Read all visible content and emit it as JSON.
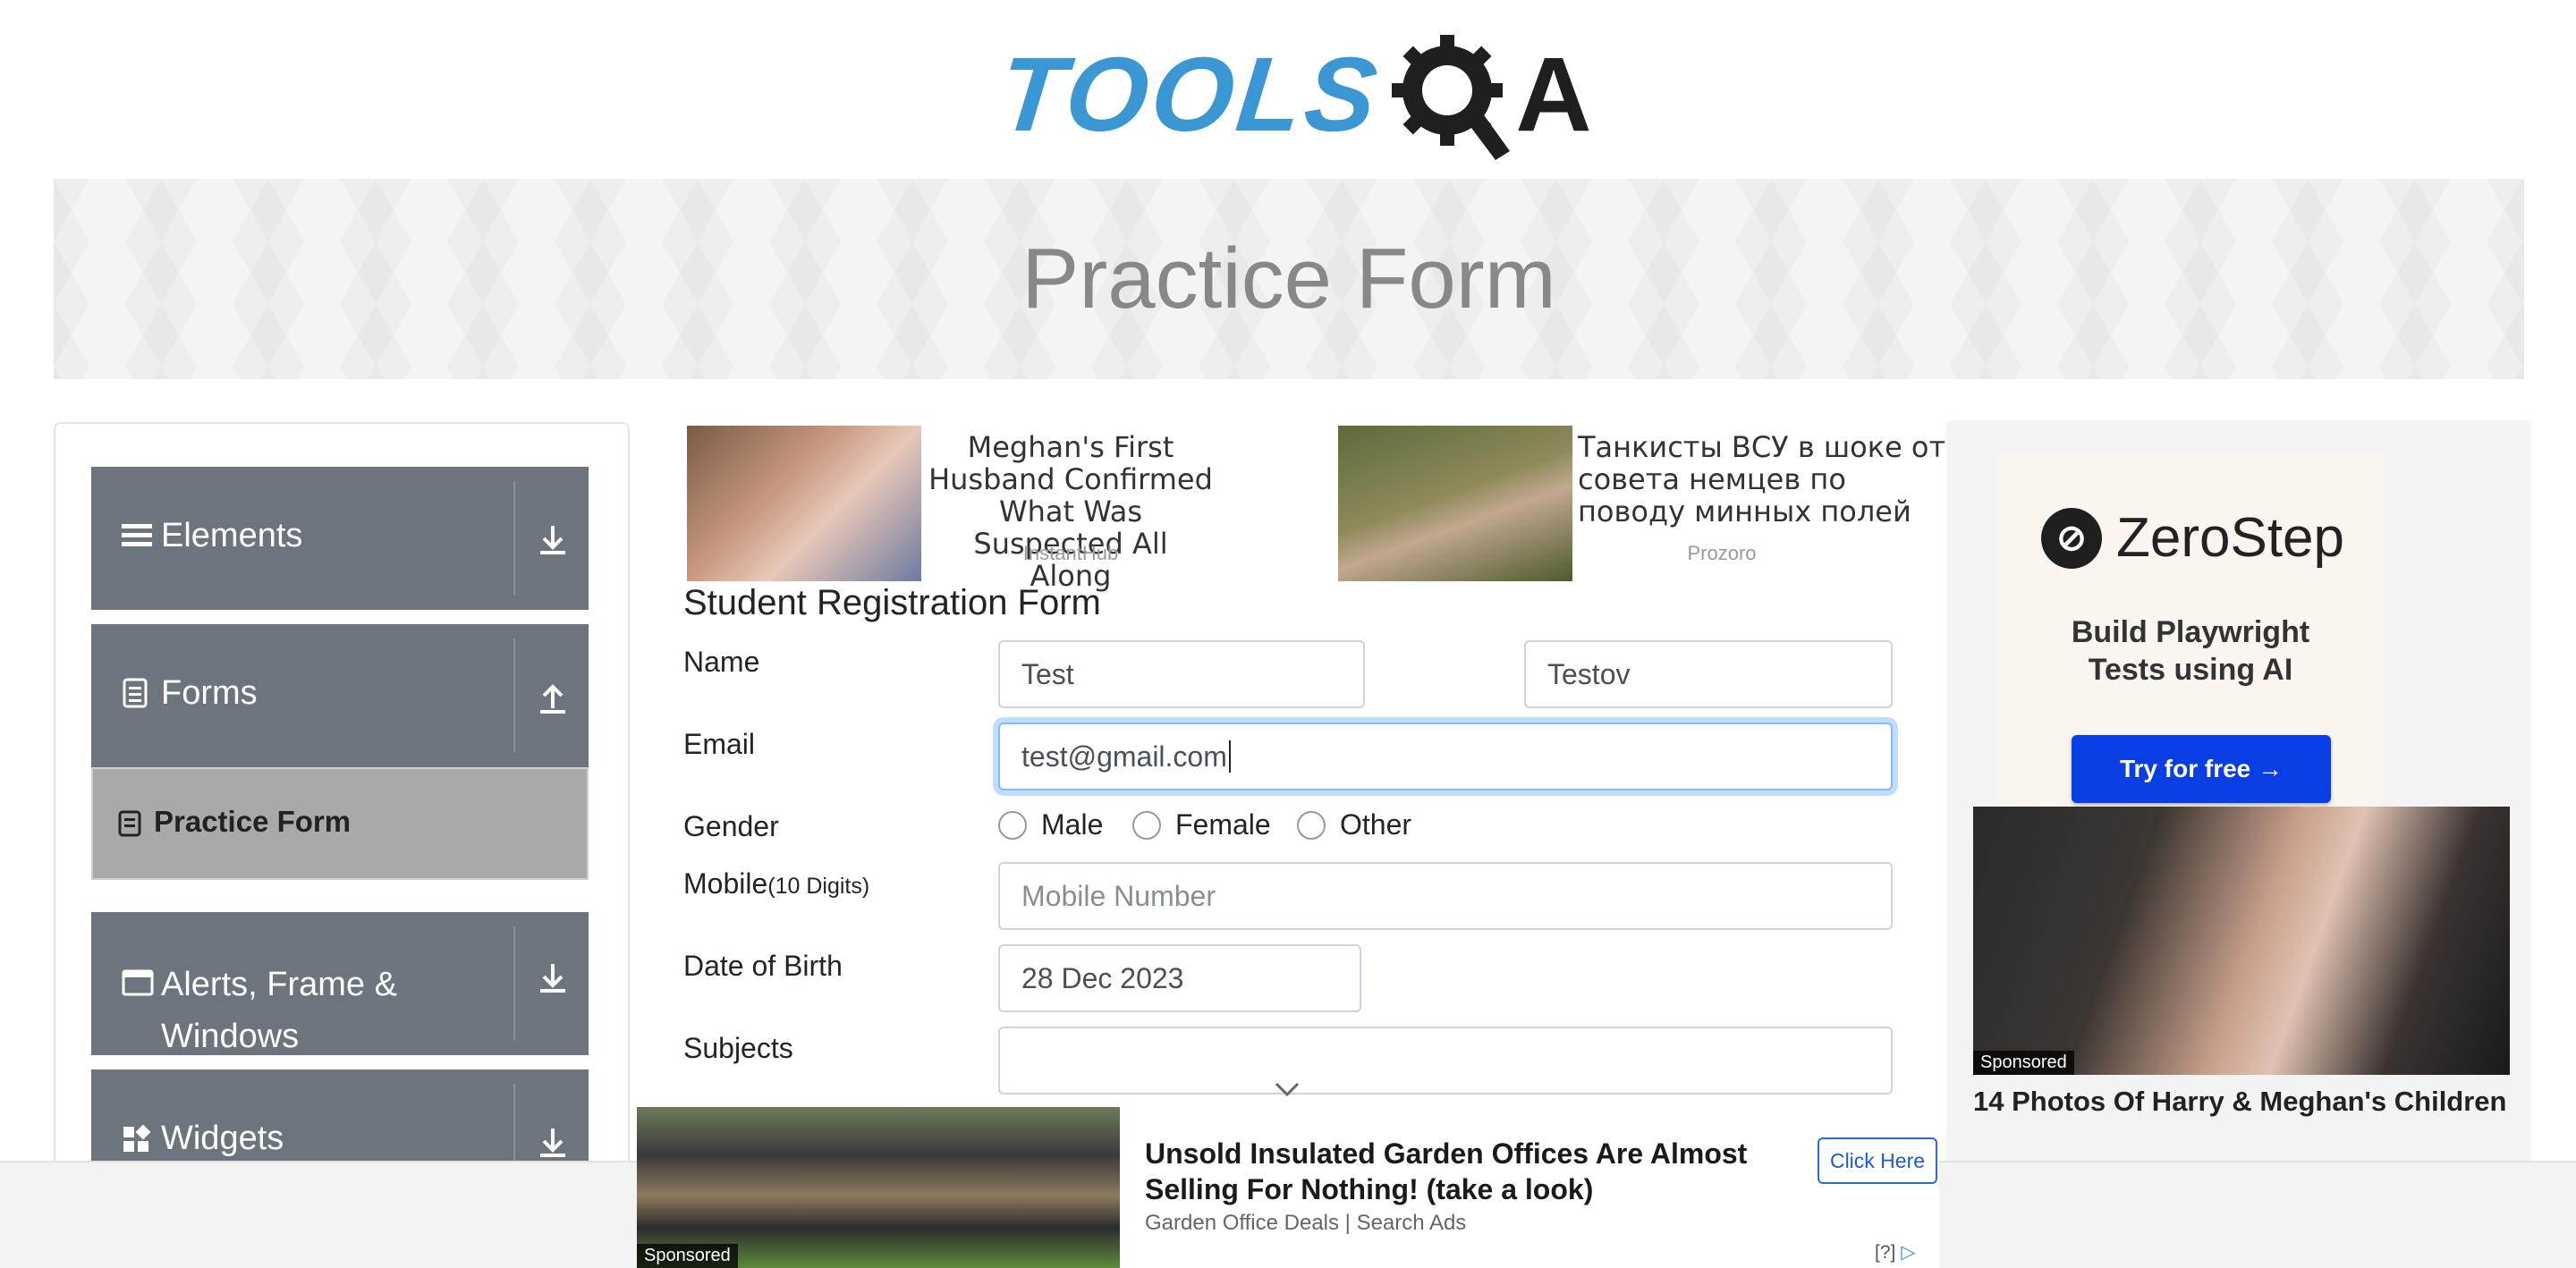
{
  "logo": {
    "text": "TOOLS",
    "suffix": "A"
  },
  "banner": {
    "title": "Practice Form"
  },
  "sidebar": {
    "groups": [
      {
        "label": "Elements"
      },
      {
        "label": "Forms"
      },
      {
        "label": "Alerts, Frame &"
      },
      {
        "label": "Widgets"
      }
    ],
    "alerts_label_line2": "Windows",
    "active_item": "Practice Form"
  },
  "ads": [
    {
      "title": "Meghan's First Husband Confirmed What Was Suspected All Along",
      "source": "InstantHub"
    },
    {
      "title": "Танкисты ВСУ в шоке от совета немцев по поводу минных полей",
      "source": "Prozoro"
    }
  ],
  "form": {
    "title": "Student Registration Form",
    "labels": {
      "name": "Name",
      "email": "Email",
      "gender": "Gender",
      "mobile": "Mobile",
      "mobile_hint": "(10 Digits)",
      "dob": "Date of Birth",
      "subjects": "Subjects"
    },
    "first_name": "Test",
    "last_name": "Testov",
    "email": "test@gmail.com",
    "gender_options": [
      "Male",
      "Female",
      "Other"
    ],
    "mobile_placeholder": "Mobile Number",
    "dob": "28 Dec 2023",
    "subjects": ""
  },
  "right_ad": {
    "brand": "ZeroStep",
    "tagline": "Build Playwright Tests using AI",
    "cta": "Try for free →",
    "sponsored": "Sponsored",
    "article_title": "14 Photos Of Harry & Meghan's Children"
  },
  "bottom_ad": {
    "title": "Unsold Insulated Garden Offices Are Almost Selling For Nothing! (take a look)",
    "source": "Garden Office Deals | Search Ads",
    "cta": "Click Here",
    "sponsored": "Sponsored",
    "help": "[?]"
  }
}
